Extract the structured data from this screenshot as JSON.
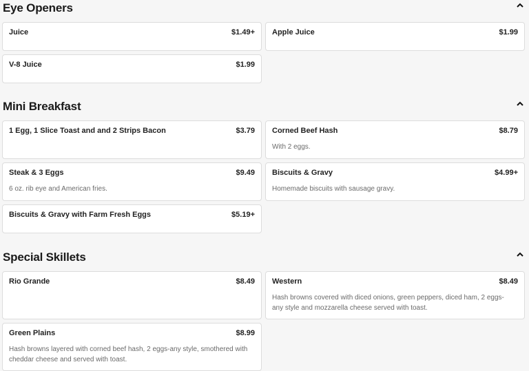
{
  "sections": [
    {
      "title": "Eye Openers",
      "items": [
        {
          "name": "Juice",
          "price": "$1.49+",
          "desc": ""
        },
        {
          "name": "Apple Juice",
          "price": "$1.99",
          "desc": ""
        },
        {
          "name": "V-8 Juice",
          "price": "$1.99",
          "desc": ""
        }
      ]
    },
    {
      "title": "Mini Breakfast",
      "items": [
        {
          "name": "1 Egg, 1 Slice Toast and and 2 Strips Bacon",
          "price": "$3.79",
          "desc": ""
        },
        {
          "name": "Corned Beef Hash",
          "price": "$8.79",
          "desc": "With 2 eggs."
        },
        {
          "name": "Steak & 3 Eggs",
          "price": "$9.49",
          "desc": "6 oz. rib eye and American fries."
        },
        {
          "name": "Biscuits & Gravy",
          "price": "$4.99+",
          "desc": "Homemade biscuits with sausage gravy."
        },
        {
          "name": "Biscuits & Gravy with Farm Fresh Eggs",
          "price": "$5.19+",
          "desc": ""
        }
      ]
    },
    {
      "title": "Special Skillets",
      "items": [
        {
          "name": "Rio Grande",
          "price": "$8.49",
          "desc": ""
        },
        {
          "name": "Western",
          "price": "$8.49",
          "desc": "Hash browns covered with diced onions, green peppers, diced ham, 2 eggs-any style and mozzarella cheese served with toast."
        },
        {
          "name": "Green Plains",
          "price": "$8.99",
          "desc": "Hash browns layered with corned beef hash, 2 eggs-any style, smothered with cheddar cheese and served with toast."
        }
      ]
    }
  ],
  "icons": {
    "collapse": "chevron-up-icon"
  }
}
